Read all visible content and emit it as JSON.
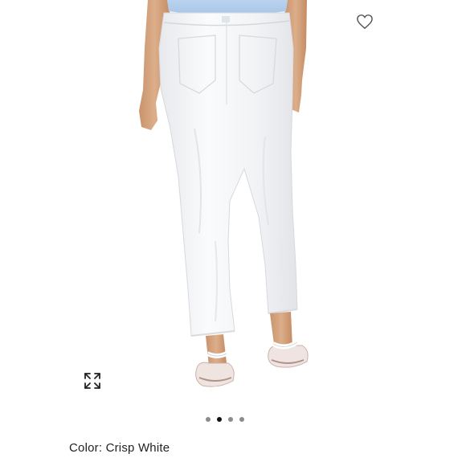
{
  "product": {
    "image_alt": "White cropped straight-leg jeans, back view, worn with white sandals",
    "color_label": "Color: Crisp White"
  },
  "carousel": {
    "dots": [
      {
        "index": 1,
        "active": false
      },
      {
        "index": 2,
        "active": true
      },
      {
        "index": 3,
        "active": false
      },
      {
        "index": 4,
        "active": false
      }
    ]
  },
  "icons": {
    "favorite": "heart-outline-icon",
    "expand": "expand-arrows-icon"
  },
  "colors": {
    "background": "#ffffff",
    "dot_active": "#111111",
    "dot_inactive": "#8c8c8c",
    "text": "#222222",
    "icon_stroke": "#555555"
  }
}
